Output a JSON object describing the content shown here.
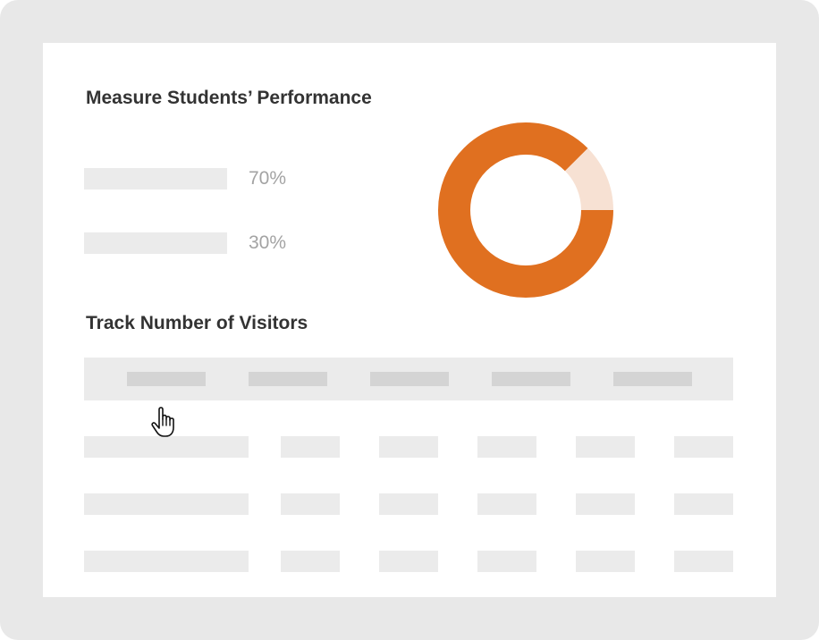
{
  "colors": {
    "frame": "#e8e8e8",
    "card": "#ffffff",
    "title": "#333333",
    "placeholder": "#ebebeb",
    "placeholder_dark": "#d4d4d4",
    "stat_label": "#a3a3a3",
    "accent": "#e07020",
    "accent_light": "#f7e1d3"
  },
  "performance": {
    "title": "Measure Students’ Performance",
    "stats": [
      {
        "label": "70%"
      },
      {
        "label": "30%"
      }
    ],
    "donut": {
      "shares": [
        0.875,
        0.125
      ],
      "colors": [
        "#e07020",
        "#f7e1d3"
      ]
    }
  },
  "visitors": {
    "title": "Track Number of Visitors",
    "header_columns": 5,
    "rows": 3,
    "columns_per_row": 6
  },
  "cursor": {
    "icon": "hand-pointer-icon"
  }
}
